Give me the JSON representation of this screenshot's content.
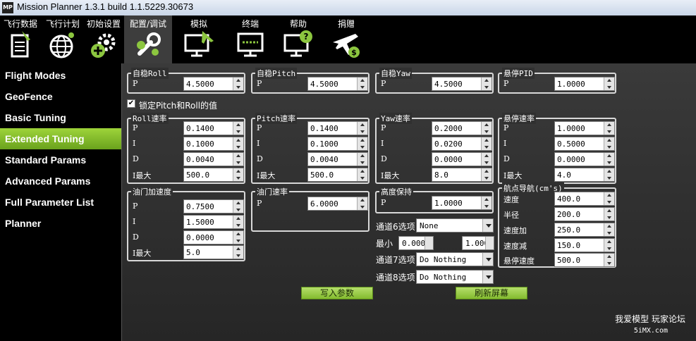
{
  "window": {
    "title": "Mission Planner 1.3.1 build 1.1.5229.30673",
    "app_icon_text": "MP"
  },
  "toolbar": {
    "items": [
      {
        "label": "飞行数据",
        "icon": "flight-data-icon"
      },
      {
        "label": "飞行计划",
        "icon": "flight-plan-icon"
      },
      {
        "label": "初始设置",
        "icon": "initial-setup-icon"
      },
      {
        "label": "配置/调试",
        "icon": "config-tuning-icon"
      },
      {
        "label": "模拟",
        "icon": "simulation-icon"
      },
      {
        "label": "终端",
        "icon": "terminal-icon"
      },
      {
        "label": "帮助",
        "icon": "help-icon"
      },
      {
        "label": "捐赠",
        "icon": "donate-icon"
      }
    ]
  },
  "sidebar": {
    "items": [
      {
        "label": "Flight Modes"
      },
      {
        "label": "GeoFence"
      },
      {
        "label": "Basic Tuning"
      },
      {
        "label": "Extended Tuning"
      },
      {
        "label": "Standard Params"
      },
      {
        "label": "Advanced Params"
      },
      {
        "label": "Full Parameter List"
      },
      {
        "label": "Planner"
      }
    ]
  },
  "groups": {
    "stab_roll": {
      "title": "自稳Roll",
      "rows": [
        {
          "label": "P",
          "value": "4.5000"
        }
      ]
    },
    "stab_pitch": {
      "title": "自稳Pitch",
      "rows": [
        {
          "label": "P",
          "value": "4.5000"
        }
      ]
    },
    "stab_yaw": {
      "title": "自稳Yaw",
      "rows": [
        {
          "label": "P",
          "value": "4.5000"
        }
      ]
    },
    "loiter_pid": {
      "title": "悬停PID",
      "rows": [
        {
          "label": "P",
          "value": "1.0000"
        }
      ]
    },
    "rate_roll": {
      "title": "Roll速率",
      "rows": [
        {
          "label": "P",
          "value": "0.1400"
        },
        {
          "label": "I",
          "value": "0.1000"
        },
        {
          "label": "D",
          "value": "0.0040"
        },
        {
          "label": "I最大",
          "value": "500.0"
        }
      ]
    },
    "rate_pitch": {
      "title": "Pitch速率",
      "rows": [
        {
          "label": "P",
          "value": "0.1400"
        },
        {
          "label": "I",
          "value": "0.1000"
        },
        {
          "label": "D",
          "value": "0.0040"
        },
        {
          "label": "I最大",
          "value": "500.0"
        }
      ]
    },
    "rate_yaw": {
      "title": "Yaw速率",
      "rows": [
        {
          "label": "P",
          "value": "0.2000"
        },
        {
          "label": "I",
          "value": "0.0200"
        },
        {
          "label": "D",
          "value": "0.0000"
        },
        {
          "label": "I最大",
          "value": "8.0"
        }
      ]
    },
    "rate_loiter": {
      "title": "悬停速率",
      "rows": [
        {
          "label": "P",
          "value": "1.0000"
        },
        {
          "label": "I",
          "value": "0.5000"
        },
        {
          "label": "D",
          "value": "0.0000"
        },
        {
          "label": "I最大",
          "value": "4.0"
        }
      ]
    },
    "throttle_accel": {
      "title": "油门加速度",
      "rows": [
        {
          "label": "P",
          "value": "0.7500"
        },
        {
          "label": "I",
          "value": "1.5000"
        },
        {
          "label": "D",
          "value": "0.0000"
        },
        {
          "label": "I最大",
          "value": "5.0"
        }
      ]
    },
    "throttle_rate": {
      "title": "油门速率",
      "rows": [
        {
          "label": "P",
          "value": "6.0000"
        }
      ]
    },
    "alt_hold": {
      "title": "高度保持",
      "rows": [
        {
          "label": "P",
          "value": "1.0000"
        }
      ]
    },
    "waypoint_nav": {
      "title": "航点导航(cm's)",
      "rows": [
        {
          "label": "速度",
          "value": "400.0"
        },
        {
          "label": "半径",
          "value": "200.0"
        },
        {
          "label": "速度加",
          "value": "250.0"
        },
        {
          "label": "速度减",
          "value": "150.0"
        },
        {
          "label": "悬停速度",
          "value": "500.0"
        }
      ]
    }
  },
  "lock_checkbox": {
    "label": "锁定Pitch和Roll的值",
    "checked": true,
    "mark": "✔"
  },
  "channels": {
    "ch6_label": "通道6选项",
    "ch6_value": "None",
    "min_label": "最小",
    "min_value": "0.0000",
    "max_value": "1.000",
    "ch7_label": "通道7选项",
    "ch7_value": "Do Nothing",
    "ch8_label": "通道8选项",
    "ch8_value": "Do Nothing"
  },
  "buttons": {
    "write": "写入参数",
    "refresh": "刷新屏幕"
  },
  "footer": {
    "brand": "我爱模型 玩家论坛",
    "site": "5iMX.com"
  },
  "colors": {
    "accent_green": "#8cc63f",
    "panel_bg": "#2f2f2f"
  }
}
